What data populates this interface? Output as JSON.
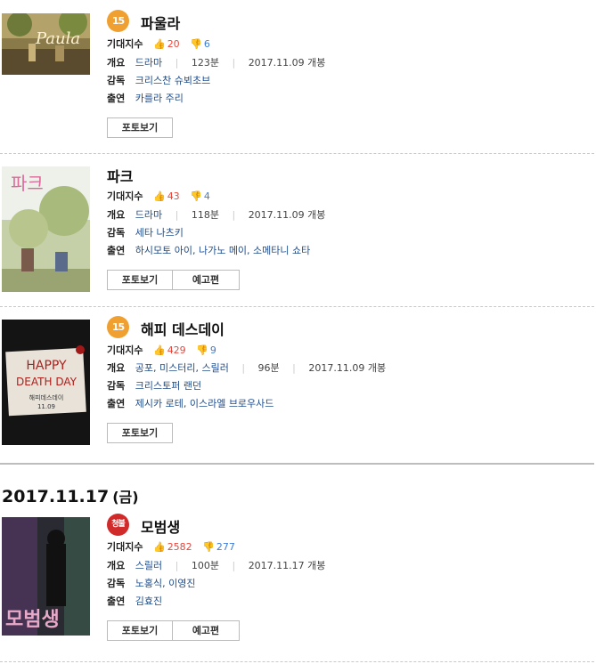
{
  "labels": {
    "expect": "기대지수",
    "summary": "개요",
    "director": "감독",
    "cast": "출연",
    "photo_button": "포토보기",
    "trailer_button": "예고편"
  },
  "date_heading": {
    "date": "2017.11.17",
    "day": "(금)"
  },
  "movies": [
    {
      "title": "파울라",
      "grade": "15",
      "likes": "20",
      "dislikes": "6",
      "genre": "드라마",
      "runtime": "123분",
      "release": "2017.11.09 개봉",
      "director": "크리스찬 슈뵈초브",
      "cast": "카를라 주리",
      "poster_text": "Paula"
    },
    {
      "title": "파크",
      "grade": "",
      "likes": "43",
      "dislikes": "4",
      "genre": "드라마",
      "runtime": "118분",
      "release": "2017.11.09 개봉",
      "director": "세타 나츠키",
      "cast": "하시모토 아이, 나가노 메이, 소메타니 쇼타",
      "poster_text": "파크"
    },
    {
      "title": "해피 데스데이",
      "grade": "15",
      "likes": "429",
      "dislikes": "9",
      "genre": "공포, 미스터리, 스릴러",
      "runtime": "96분",
      "release": "2017.11.09 개봉",
      "director": "크리스토퍼 랜던",
      "cast": "제시카 로테, 이스라엘 브로우사드",
      "poster_text": [
        "HAPPY",
        "DEATH DAY",
        "해피데스데이",
        "11.09"
      ]
    },
    {
      "title": "모범생",
      "grade": "청불",
      "likes": "2582",
      "dislikes": "277",
      "genre": "스릴러",
      "runtime": "100분",
      "release": "2017.11.17 개봉",
      "director": "노홍식, 이영진",
      "cast": "김효진",
      "poster_text": "모범생"
    }
  ],
  "colors": {
    "like": "#e8473c",
    "dislike": "#3d7dd8",
    "grade_15": "#f0a030",
    "grade_adult": "#d02a2a",
    "link": "#1f4d8c"
  },
  "icons": {
    "like": "thumbs-up-icon",
    "dislike": "thumbs-down-icon"
  }
}
